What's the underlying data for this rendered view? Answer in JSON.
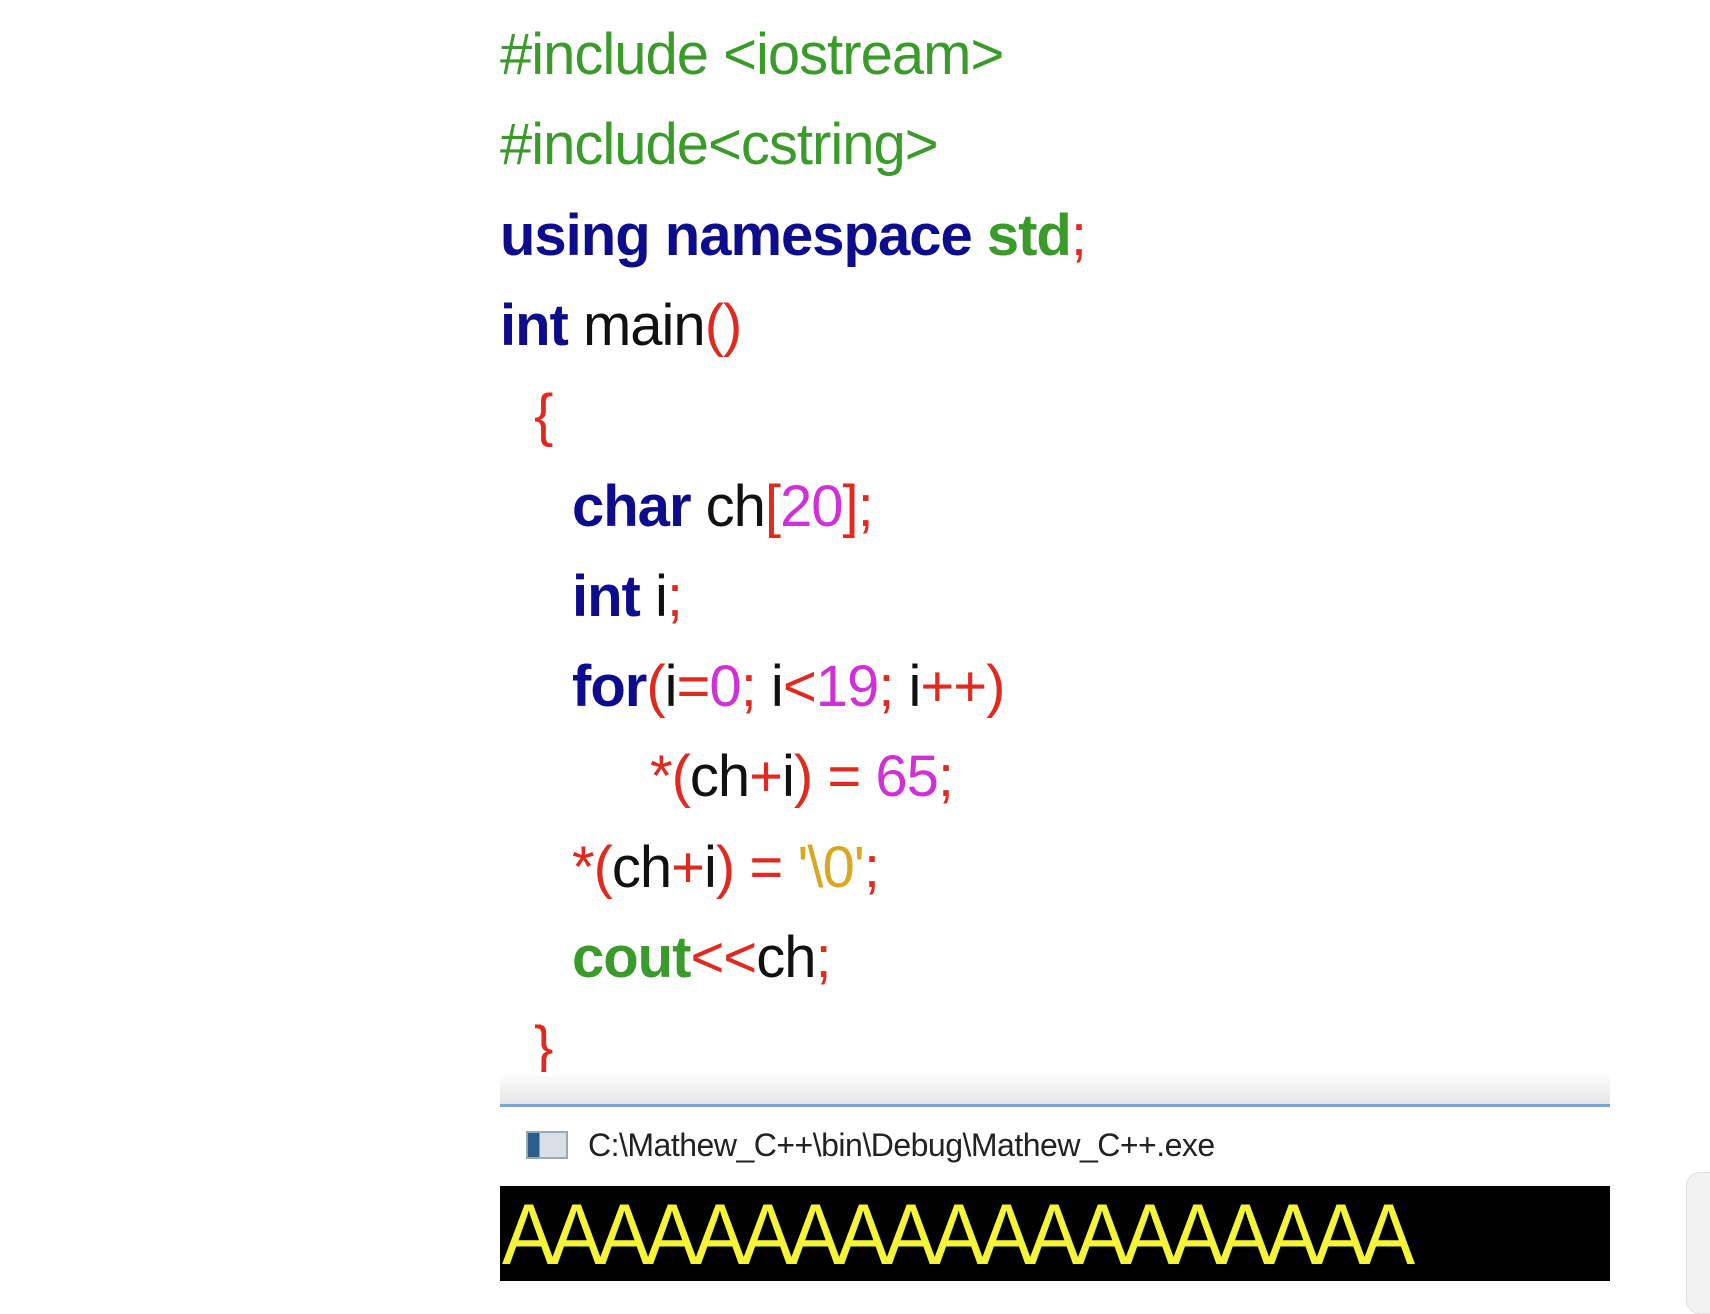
{
  "code": {
    "lines": [
      {
        "indent": 0,
        "tokens": [
          {
            "text": "#include <iostream>",
            "cls": "t-green"
          }
        ]
      },
      {
        "indent": 0,
        "tokens": [
          {
            "text": "#include<cstring>",
            "cls": "t-green"
          }
        ]
      },
      {
        "indent": 0,
        "tokens": [
          {
            "text": "using namespace ",
            "cls": "t-navy"
          },
          {
            "text": "std",
            "cls": "t-green-b"
          },
          {
            "text": ";",
            "cls": "t-red"
          }
        ]
      },
      {
        "indent": 0,
        "tokens": [
          {
            "text": "int",
            "cls": "t-navy"
          },
          {
            "text": " main",
            "cls": "t-black"
          },
          {
            "text": "()",
            "cls": "t-red"
          }
        ]
      },
      {
        "indent": 1,
        "tokens": [
          {
            "text": "{",
            "cls": "t-red"
          }
        ]
      },
      {
        "indent": 2,
        "tokens": [
          {
            "text": "char",
            "cls": "t-navy"
          },
          {
            "text": " ch",
            "cls": "t-black"
          },
          {
            "text": "[",
            "cls": "t-red"
          },
          {
            "text": "20",
            "cls": "t-mag"
          },
          {
            "text": "];",
            "cls": "t-red"
          }
        ]
      },
      {
        "indent": 2,
        "tokens": [
          {
            "text": "int",
            "cls": "t-navy"
          },
          {
            "text": " i",
            "cls": "t-black"
          },
          {
            "text": ";",
            "cls": "t-red"
          }
        ]
      },
      {
        "indent": 2,
        "tokens": [
          {
            "text": "for",
            "cls": "t-navy"
          },
          {
            "text": "(",
            "cls": "t-red"
          },
          {
            "text": "i",
            "cls": "t-black"
          },
          {
            "text": "=",
            "cls": "t-red"
          },
          {
            "text": "0",
            "cls": "t-mag"
          },
          {
            "text": ";",
            "cls": "t-red"
          },
          {
            "text": " i",
            "cls": "t-black"
          },
          {
            "text": "<",
            "cls": "t-red"
          },
          {
            "text": "19",
            "cls": "t-mag"
          },
          {
            "text": ";",
            "cls": "t-red"
          },
          {
            "text": " i",
            "cls": "t-black"
          },
          {
            "text": "++)",
            "cls": "t-red"
          }
        ]
      },
      {
        "indent": 3,
        "tokens": [
          {
            "text": "*(",
            "cls": "t-red"
          },
          {
            "text": "ch",
            "cls": "t-black"
          },
          {
            "text": "+",
            "cls": "t-red"
          },
          {
            "text": "i",
            "cls": "t-black"
          },
          {
            "text": ") = ",
            "cls": "t-red"
          },
          {
            "text": "65",
            "cls": "t-mag"
          },
          {
            "text": ";",
            "cls": "t-red"
          }
        ]
      },
      {
        "indent": 2,
        "tokens": [
          {
            "text": "*(",
            "cls": "t-red"
          },
          {
            "text": "ch",
            "cls": "t-black"
          },
          {
            "text": "+",
            "cls": "t-red"
          },
          {
            "text": "i",
            "cls": "t-black"
          },
          {
            "text": ") = ",
            "cls": "t-red"
          },
          {
            "text": "'\\0'",
            "cls": "t-gold"
          },
          {
            "text": ";",
            "cls": "t-red"
          }
        ]
      },
      {
        "indent": 2,
        "tokens": [
          {
            "text": "cout",
            "cls": "t-green-b"
          },
          {
            "text": "<<",
            "cls": "t-red"
          },
          {
            "text": "ch",
            "cls": "t-black"
          },
          {
            "text": ";",
            "cls": "t-red"
          }
        ]
      },
      {
        "indent": 1,
        "tokens": [
          {
            "text": "}",
            "cls": "t-red"
          }
        ]
      }
    ]
  },
  "console": {
    "icon": "console-window-icon",
    "title": "C:\\Mathew_C++\\bin\\Debug\\Mathew_C++.exe",
    "output": "AAAAAAAAAAAAAAAAAAA"
  }
}
